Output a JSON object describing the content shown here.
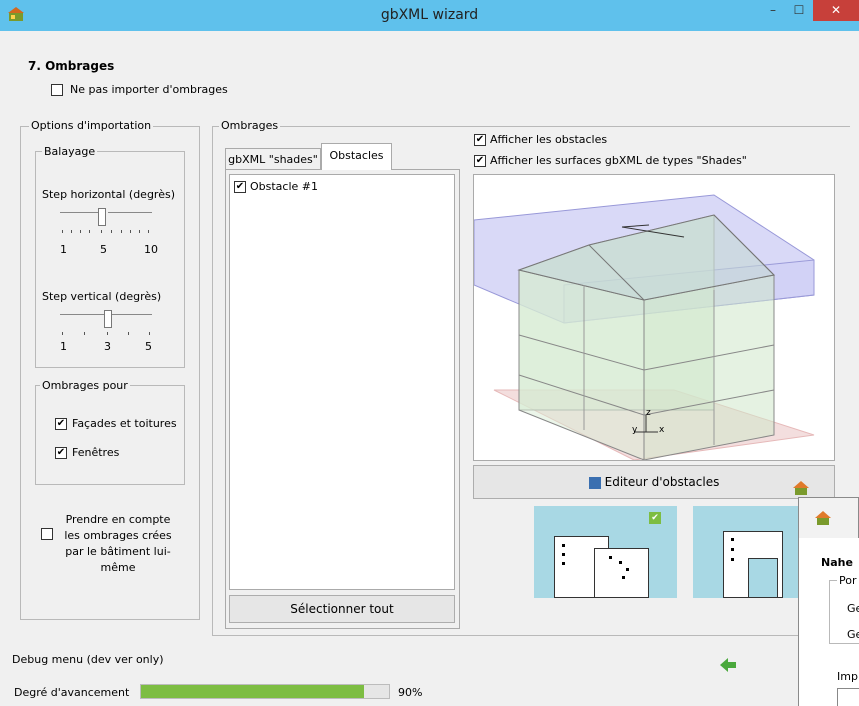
{
  "window": {
    "title": "gbXML wizard",
    "minimize": "–",
    "maximize": "☐",
    "close": "✕"
  },
  "step": {
    "title": "7.  Ombrages",
    "skip_label": "Ne pas importer d'ombrages"
  },
  "import_options": {
    "legend": "Options d'importation",
    "sweep": {
      "legend": "Balayage",
      "horizontal": {
        "label": "Step horizontal (degrès)",
        "min": "1",
        "mid": "5",
        "max": "10",
        "value": 5
      },
      "vertical": {
        "label": "Step vertical (degrès)",
        "min": "1",
        "mid": "3",
        "max": "5",
        "value": 3
      }
    },
    "shading_for": {
      "legend": "Ombrages pour",
      "facades_label": "Façades et toitures",
      "windows_label": "Fenêtres"
    },
    "self_shading_label": "Prendre en compte les ombrages crées par le bâtiment lui-même"
  },
  "shades": {
    "legend": "Ombrages",
    "tabs": [
      "gbXML \"shades\"",
      "Obstacles"
    ],
    "obstacles": [
      {
        "label": "Obstacle #1",
        "checked": true
      }
    ],
    "select_all": "Sélectionner tout",
    "show_obstacles": "Afficher les obstacles",
    "show_gbxml_shades": "Afficher les surfaces gbXML de types \"Shades\"",
    "axis_y": "y",
    "axis_x": "x",
    "axis_z": "z",
    "editor_button": "Editeur d'obstacles"
  },
  "footer": {
    "debug_label": "Debug menu (dev ver only)",
    "progress_label": "Degré d'avancement",
    "progress_percent": "90%",
    "progress_value": 0.9
  },
  "overlay": {
    "heading": "Nahe",
    "group": "Por",
    "row1": "Ge",
    "row2": "Ge",
    "imp": "Imp"
  },
  "colors": {
    "titlebar": "#5fc1ec",
    "close": "#c7403a",
    "progress": "#7dbd42",
    "thumb": "#a8d8e4"
  }
}
